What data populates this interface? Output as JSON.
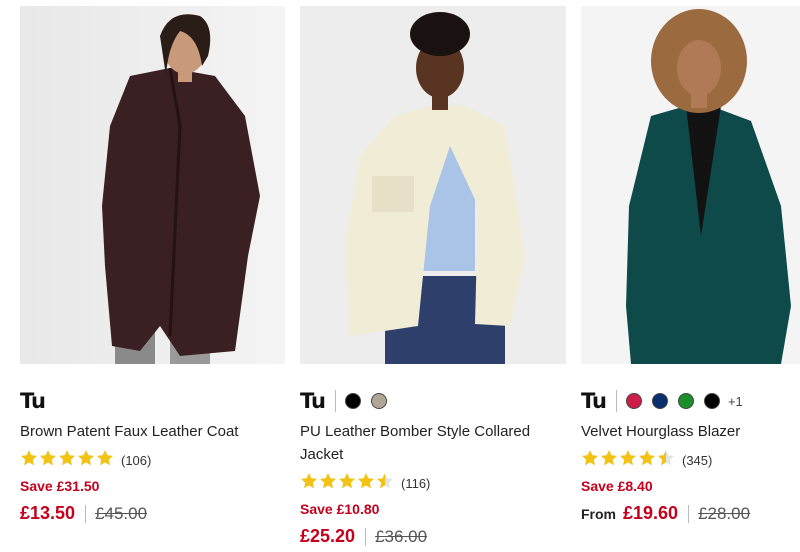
{
  "products": [
    {
      "brand": "Tu",
      "name": "Brown Patent Faux Leather Coat",
      "rating": 5,
      "reviews": "(106)",
      "save": "Save £31.50",
      "price_prefix": "",
      "price": "£13.50",
      "was_price": "£45.00",
      "swatches": [],
      "more_colours": ""
    },
    {
      "brand": "Tu",
      "name": "PU Leather Bomber Style Collared Jacket",
      "rating": 4.5,
      "reviews": "(116)",
      "save": "Save £10.80",
      "price_prefix": "",
      "price": "£25.20",
      "was_price": "£36.00",
      "swatches": [
        "#000000",
        "#b1a595"
      ],
      "more_colours": ""
    },
    {
      "brand": "Tu",
      "name": "Velvet Hourglass Blazer",
      "rating": 4.5,
      "reviews": "(345)",
      "save": "Save £8.40",
      "price_prefix": "From",
      "price": "£19.60",
      "was_price": "£28.00",
      "swatches": [
        "#cc1e48",
        "#0a2f6e",
        "#1c8f2a",
        "#000000"
      ],
      "more_colours": "+1"
    }
  ],
  "colors": {
    "sale_red": "#c4001d",
    "star_gold": "#f2c313"
  }
}
